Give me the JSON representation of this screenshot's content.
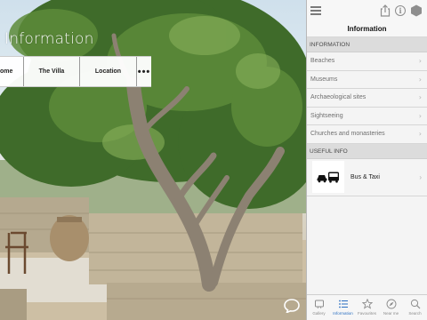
{
  "page": {
    "title": "Information"
  },
  "top_tabs": [
    {
      "label": "ome"
    },
    {
      "label": "The Villa"
    },
    {
      "label": "Location"
    },
    {
      "label": "•••"
    }
  ],
  "panel": {
    "title": "Information",
    "sections": [
      {
        "header": "INFORMATION",
        "items": [
          {
            "label": "Beaches"
          },
          {
            "label": "Museums"
          },
          {
            "label": "Archaeological sites"
          },
          {
            "label": "Sightseeing"
          },
          {
            "label": "Churches and monasteries"
          }
        ]
      },
      {
        "header": "USEFUL INFO",
        "items": [
          {
            "label": "Bus & Taxi",
            "icon": "bus-taxi-icon"
          }
        ]
      }
    ],
    "chevron": "›"
  },
  "bottom_tabs": [
    {
      "label": "Gallery",
      "icon": "gallery-icon",
      "active": false
    },
    {
      "label": "Information",
      "icon": "list-icon",
      "active": true
    },
    {
      "label": "Favourites",
      "icon": "star-icon",
      "active": false
    },
    {
      "label": "Near me",
      "icon": "compass-icon",
      "active": false
    },
    {
      "label": "Search",
      "icon": "search-icon",
      "active": false
    }
  ],
  "colors": {
    "accent": "#2b6fc1",
    "panel_bg": "#f4f4f4",
    "section_bg": "#dcdcdc"
  }
}
